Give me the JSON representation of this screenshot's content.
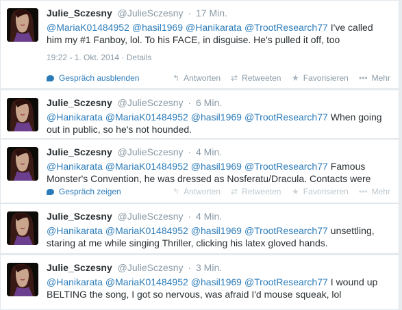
{
  "actions_labels": {
    "reply": "Antworten",
    "retweet": "Retweeten",
    "favorite": "Favorisieren",
    "more": "Mehr"
  },
  "tweets": [
    {
      "name": "Julie_Sczesny",
      "handle": "@JulieSczesny",
      "time": "17 Min.",
      "line1_mentions": [
        "@MariaK01484952",
        "@hasil1969",
        "@Hanikarata",
        "@TrootResearch77"
      ],
      "line1_text": "I've called",
      "line2_text": "him my #1 Fanboy, lol. To his FACE, in disguise. He's pulled it off, too",
      "details": "19:22 - 1. Okt. 2014 · Details",
      "conversation": "Gespräch ausblenden"
    },
    {
      "name": "Julie_Sczesny",
      "handle": "@JulieSczesny",
      "time": "6 Min.",
      "line1_mentions": [
        "@Hanikarata",
        "@MariaK01484952",
        "@hasil1969",
        "@TrootResearch77"
      ],
      "line1_text": "When going",
      "line2_text": "out in public, so he's not hounded."
    },
    {
      "name": "Julie_Sczesny",
      "handle": "@JulieSczesny",
      "time": "4 Min.",
      "line1_mentions": [
        "@Hanikarata",
        "@MariaK01484952",
        "@hasil1969",
        "@TrootResearch77"
      ],
      "line1_text": "Famous",
      "line2_text": "Monster's Convention, he was dressed as Nosferatu/Dracula. Contacts were",
      "conversation": "Gespräch zeigen"
    },
    {
      "name": "Julie_Sczesny",
      "handle": "@JulieSczesny",
      "time": "4 Min.",
      "line1_mentions": [
        "@Hanikarata",
        "@MariaK01484952",
        "@hasil1969",
        "@TrootResearch77"
      ],
      "line1_text": "unsettling,",
      "line2_text": "staring at me while singing Thriller, clicking his latex gloved hands."
    },
    {
      "name": "Julie_Sczesny",
      "handle": "@JulieSczesny",
      "time": "3 Min.",
      "line1_mentions": [
        "@Hanikarata",
        "@MariaK01484952",
        "@hasil1969",
        "@TrootResearch77"
      ],
      "line1_text": "I wound up",
      "line2_text": "BELTING the song, I got so nervous, was afraid I'd mouse squeak, lol"
    }
  ],
  "colors": {
    "link": "#2b7bb9",
    "meta": "#8899a6",
    "text": "#292f33"
  },
  "icons": [
    "speech-bubble-icon",
    "reply-arrow-icon",
    "retweet-icon",
    "star-icon",
    "ellipsis-icon"
  ]
}
